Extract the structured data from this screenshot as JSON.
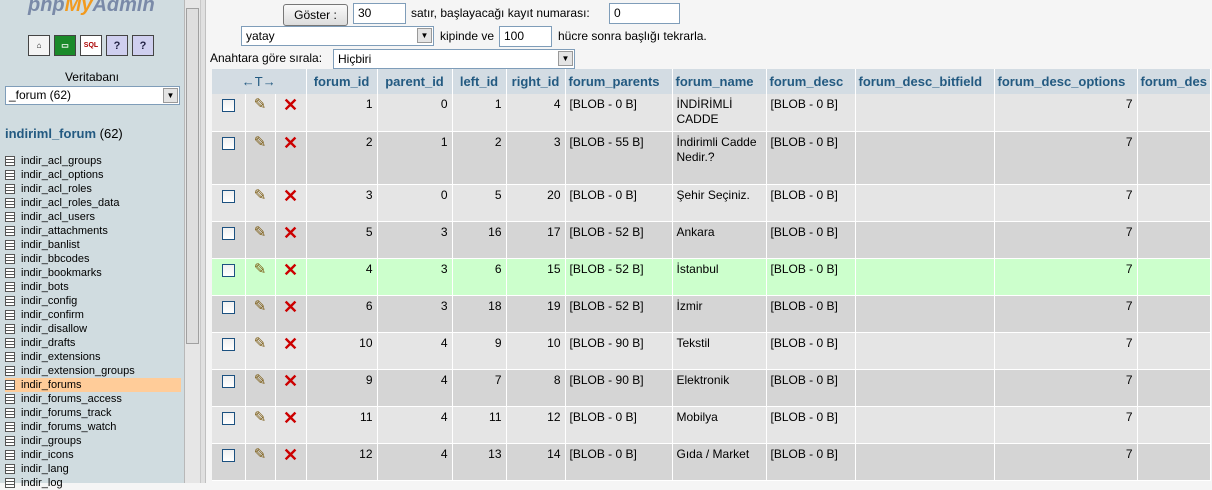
{
  "app": {
    "logo_php": "php",
    "logo_my": "My",
    "logo_admin": "Admin"
  },
  "left_panel": {
    "icons": [
      "home-icon",
      "query-window-icon",
      "sql-icon",
      "docs-icon",
      "help-icon"
    ],
    "icon_texts": [
      "⌂",
      "▭",
      "SQL",
      "?",
      "?"
    ],
    "db_label": "Veritabanı",
    "db_select_value": "_forum (62)",
    "db_title_name": "indiriml_forum",
    "db_title_count": "(62)",
    "tables": [
      "indir_acl_groups",
      "indir_acl_options",
      "indir_acl_roles",
      "indir_acl_roles_data",
      "indir_acl_users",
      "indir_attachments",
      "indir_banlist",
      "indir_bbcodes",
      "indir_bookmarks",
      "indir_bots",
      "indir_config",
      "indir_confirm",
      "indir_disallow",
      "indir_drafts",
      "indir_extensions",
      "indir_extension_groups",
      "indir_forums",
      "indir_forums_access",
      "indir_forums_track",
      "indir_forums_watch",
      "indir_groups",
      "indir_icons",
      "indir_lang",
      "indir_log"
    ],
    "selected_table": "indir_forums"
  },
  "controls": {
    "show_button": "Göster :",
    "rows_value": "30",
    "rows_text": "satır, başlayacağı kayıt numarası:",
    "start_value": "0",
    "mode_value": "yatay",
    "mode_text": "kipinde ve",
    "repeat_value": "100",
    "repeat_text": "hücre sonra başlığı tekrarla.",
    "sort_label": "Anahtara göre sırala:",
    "sort_value": "Hiçbiri"
  },
  "table": {
    "arrows": "←T→",
    "columns": [
      "forum_id",
      "parent_id",
      "left_id",
      "right_id",
      "forum_parents",
      "forum_name",
      "forum_desc",
      "forum_desc_bitfield",
      "forum_desc_options",
      "forum_des"
    ],
    "rows": [
      {
        "forum_id": "1",
        "parent_id": "0",
        "left_id": "1",
        "right_id": "4",
        "forum_parents": "[BLOB - 0 B]",
        "forum_name": "İNDİRİMLİ CADDE",
        "forum_desc": "[BLOB - 0 B]",
        "forum_desc_bitfield": "",
        "forum_desc_options": "7"
      },
      {
        "forum_id": "2",
        "parent_id": "1",
        "left_id": "2",
        "right_id": "3",
        "forum_parents": "[BLOB - 55 B]",
        "forum_name": "İndirimli Cadde Nedir.?",
        "forum_desc": "[BLOB - 0 B]",
        "forum_desc_bitfield": "",
        "forum_desc_options": "7"
      },
      {
        "forum_id": "3",
        "parent_id": "0",
        "left_id": "5",
        "right_id": "20",
        "forum_parents": "[BLOB - 0 B]",
        "forum_name": "Şehir Seçiniz.",
        "forum_desc": "[BLOB - 0 B]",
        "forum_desc_bitfield": "",
        "forum_desc_options": "7"
      },
      {
        "forum_id": "5",
        "parent_id": "3",
        "left_id": "16",
        "right_id": "17",
        "forum_parents": "[BLOB - 52 B]",
        "forum_name": "Ankara",
        "forum_desc": "[BLOB - 0 B]",
        "forum_desc_bitfield": "",
        "forum_desc_options": "7"
      },
      {
        "forum_id": "4",
        "parent_id": "3",
        "left_id": "6",
        "right_id": "15",
        "forum_parents": "[BLOB - 52 B]",
        "forum_name": "İstanbul",
        "forum_desc": "[BLOB - 0 B]",
        "forum_desc_bitfield": "",
        "forum_desc_options": "7"
      },
      {
        "forum_id": "6",
        "parent_id": "3",
        "left_id": "18",
        "right_id": "19",
        "forum_parents": "[BLOB - 52 B]",
        "forum_name": "İzmir",
        "forum_desc": "[BLOB - 0 B]",
        "forum_desc_bitfield": "",
        "forum_desc_options": "7"
      },
      {
        "forum_id": "10",
        "parent_id": "4",
        "left_id": "9",
        "right_id": "10",
        "forum_parents": "[BLOB - 90 B]",
        "forum_name": "Tekstil",
        "forum_desc": "[BLOB - 0 B]",
        "forum_desc_bitfield": "",
        "forum_desc_options": "7"
      },
      {
        "forum_id": "9",
        "parent_id": "4",
        "left_id": "7",
        "right_id": "8",
        "forum_parents": "[BLOB - 90 B]",
        "forum_name": "Elektronik",
        "forum_desc": "[BLOB - 0 B]",
        "forum_desc_bitfield": "",
        "forum_desc_options": "7"
      },
      {
        "forum_id": "11",
        "parent_id": "4",
        "left_id": "11",
        "right_id": "12",
        "forum_parents": "[BLOB - 0 B]",
        "forum_name": "Mobilya",
        "forum_desc": "[BLOB - 0 B]",
        "forum_desc_bitfield": "",
        "forum_desc_options": "7"
      },
      {
        "forum_id": "12",
        "parent_id": "4",
        "left_id": "13",
        "right_id": "14",
        "forum_parents": "[BLOB - 0 B]",
        "forum_name": "Gıda / Market",
        "forum_desc": "[BLOB - 0 B]",
        "forum_desc_bitfield": "",
        "forum_desc_options": "7"
      }
    ],
    "marked_row_index": 4
  },
  "colors": {
    "header_bg": "#d3dce3",
    "header_text": "#235a81",
    "row_odd": "#e5e5e5",
    "row_even": "#d5d5d5",
    "marked": "#ccffcc",
    "selected_table_bg": "#ffcc99"
  }
}
